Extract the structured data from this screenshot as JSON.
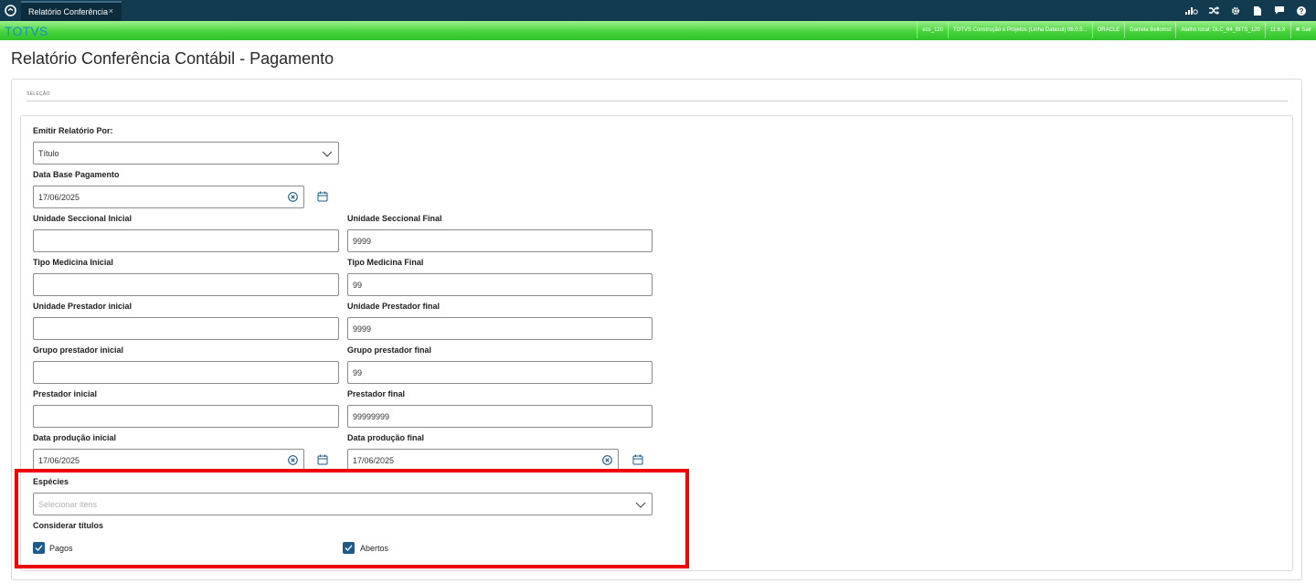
{
  "topbar": {
    "tab_label": "Relatório Conferência",
    "tab_close": "×",
    "icons": [
      "signal-icon",
      "shuffle-icon",
      "settings-icon",
      "document-icon",
      "chat-icon",
      "help-icon"
    ],
    "colors": {
      "bar": "#123b50",
      "tab": "#0c2b3b"
    }
  },
  "environment": {
    "brand": "TOTVS",
    "items": [
      "ecs_120",
      "TOTVS Construção e Projetos (Linha Datasul) 06.0.5...",
      "ORACLE",
      "Daniela Bellomst",
      "Atalho local: DLC_64_BITS_120",
      "11.6.X",
      "✖ Sair"
    ]
  },
  "page": {
    "title": "Relatório Conferência Contábil - Pagamento",
    "section_label": "SELEÇÃO"
  },
  "form": {
    "emitir_label": "Emitir Relatório Por:",
    "emitir_value": "Título",
    "data_base_label": "Data Base Pagamento",
    "data_base_value": "17/06/2025",
    "unidade_seccional_inicial_label": "Unidade Seccional Inicial",
    "unidade_seccional_inicial_value": "",
    "unidade_seccional_final_label": "Unidade Seccional Final",
    "unidade_seccional_final_value": "9999",
    "tipo_medicina_inicial_label": "Tipo Medicina Inicial",
    "tipo_medicina_inicial_value": "",
    "tipo_medicina_final_label": "Tipo Medicina Final",
    "tipo_medicina_final_value": "99",
    "unidade_prestador_inicial_label": "Unidade Prestador inicial",
    "unidade_prestador_inicial_value": "",
    "unidade_prestador_final_label": "Unidade Prestador final",
    "unidade_prestador_final_value": "9999",
    "grupo_prestador_inicial_label": "Grupo prestador inicial",
    "grupo_prestador_inicial_value": "",
    "grupo_prestador_final_label": "Grupo prestador final",
    "grupo_prestador_final_value": "99",
    "prestador_inicial_label": "Prestador inicial",
    "prestador_inicial_value": "",
    "prestador_final_label": "Prestador final",
    "prestador_final_value": "99999999",
    "data_producao_inicial_label": "Data produção inicial",
    "data_producao_inicial_value": "17/06/2025",
    "data_producao_final_label": "Data produção final",
    "data_producao_final_value": "17/06/2025",
    "especies_label": "Espécies",
    "especies_placeholder": "Selecionar itens",
    "considerar_label": "Considerar títulos",
    "pagos_label": "Pagos",
    "pagos_checked": true,
    "abertos_label": "Abertos",
    "abertos_checked": true
  },
  "colors": {
    "highlight": "#ee0000",
    "checkbox": "#1c5b8a",
    "accent_icon": "#1c5b8a"
  }
}
